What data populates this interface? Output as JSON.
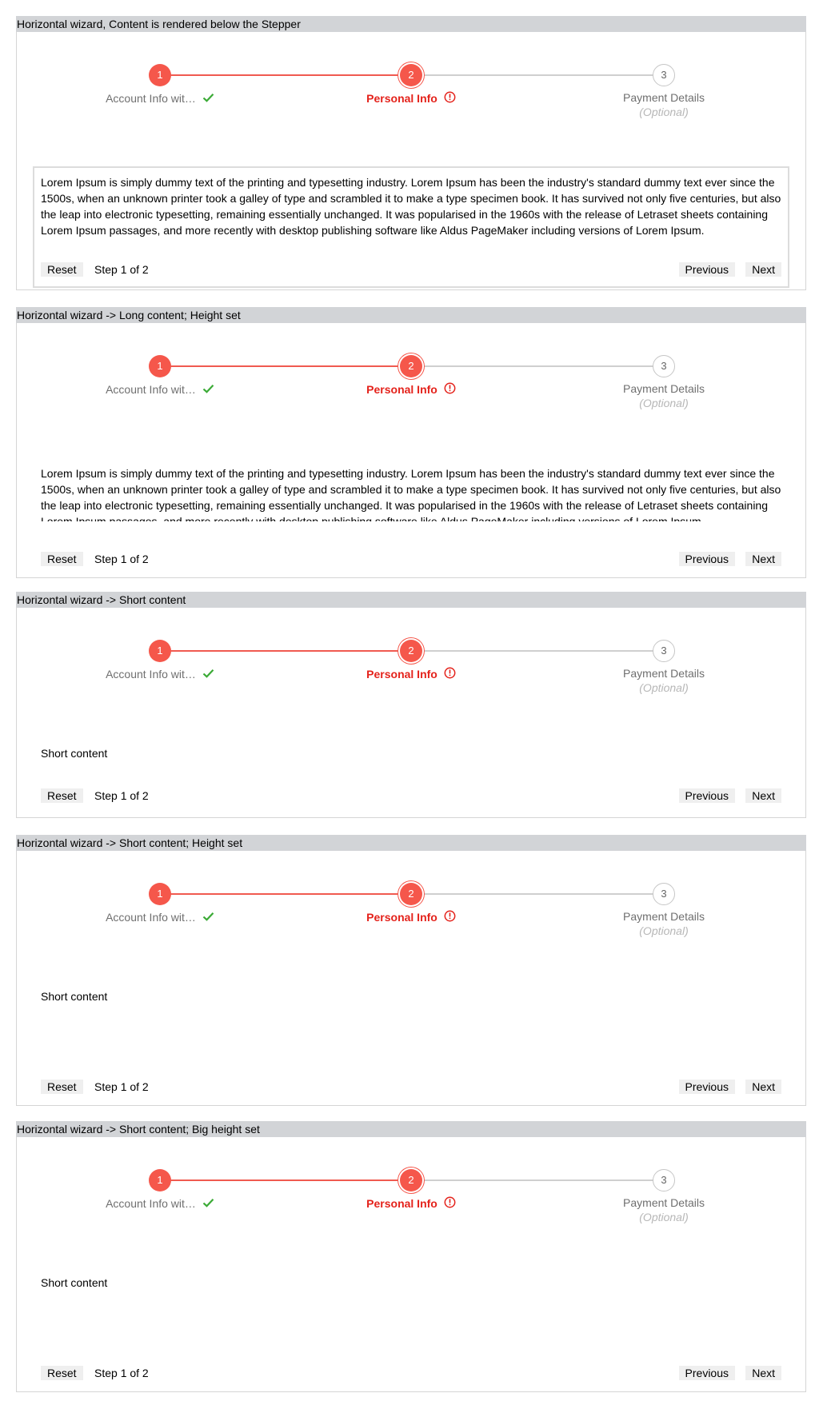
{
  "colors": {
    "accent": "#f5574b",
    "error_text": "#e4221b",
    "success": "#3aaa35",
    "title_bar": "#d2d4d7"
  },
  "wizard": {
    "steps": [
      {
        "number": "1",
        "label": "Account Info wit…",
        "state": "completed",
        "icon": "checkmark-icon"
      },
      {
        "number": "2",
        "label": "Personal Info",
        "state": "error",
        "icon": "error-circle-icon"
      },
      {
        "number": "3",
        "label": "Payment Details",
        "sub": "(Optional)",
        "state": "pending"
      }
    ],
    "reset_label": "Reset",
    "step_counter": "Step 1 of 2",
    "previous_label": "Previous",
    "next_label": "Next"
  },
  "sections": [
    {
      "title": "Horizontal wizard, Content is rendered below the Stepper",
      "content": "Lorem Ipsum is simply dummy text of the printing and typesetting industry. Lorem Ipsum has been the industry's standard dummy text ever since the 1500s, when an unknown printer took a galley of type and scrambled it to make a type specimen book. It has survived not only five centuries, but also the leap into electronic typesetting, remaining essentially unchanged. It was popularised in the 1960s with the release of Letraset sheets containing Lorem Ipsum passages, and more recently with desktop publishing software like Aldus PageMaker including versions of Lorem Ipsum."
    },
    {
      "title": "Horizontal wizard -> Long content; Height set",
      "content": "Lorem Ipsum is simply dummy text of the printing and typesetting industry. Lorem Ipsum has been the industry's standard dummy text ever since the 1500s, when an unknown printer took a galley of type and scrambled it to make a type specimen book. It has survived not only five centuries, but also the leap into electronic typesetting, remaining essentially unchanged. It was popularised in the 1960s with the release of Letraset sheets containing Lorem Ipsum passages, and more recently with desktop publishing software like Aldus PageMaker including versions of Lorem Ipsum."
    },
    {
      "title": "Horizontal wizard -> Short content",
      "content": "Short content"
    },
    {
      "title": "Horizontal wizard -> Short content; Height set",
      "content": "Short content"
    },
    {
      "title": "Horizontal wizard -> Short content; Big height set",
      "content": "Short content"
    }
  ]
}
